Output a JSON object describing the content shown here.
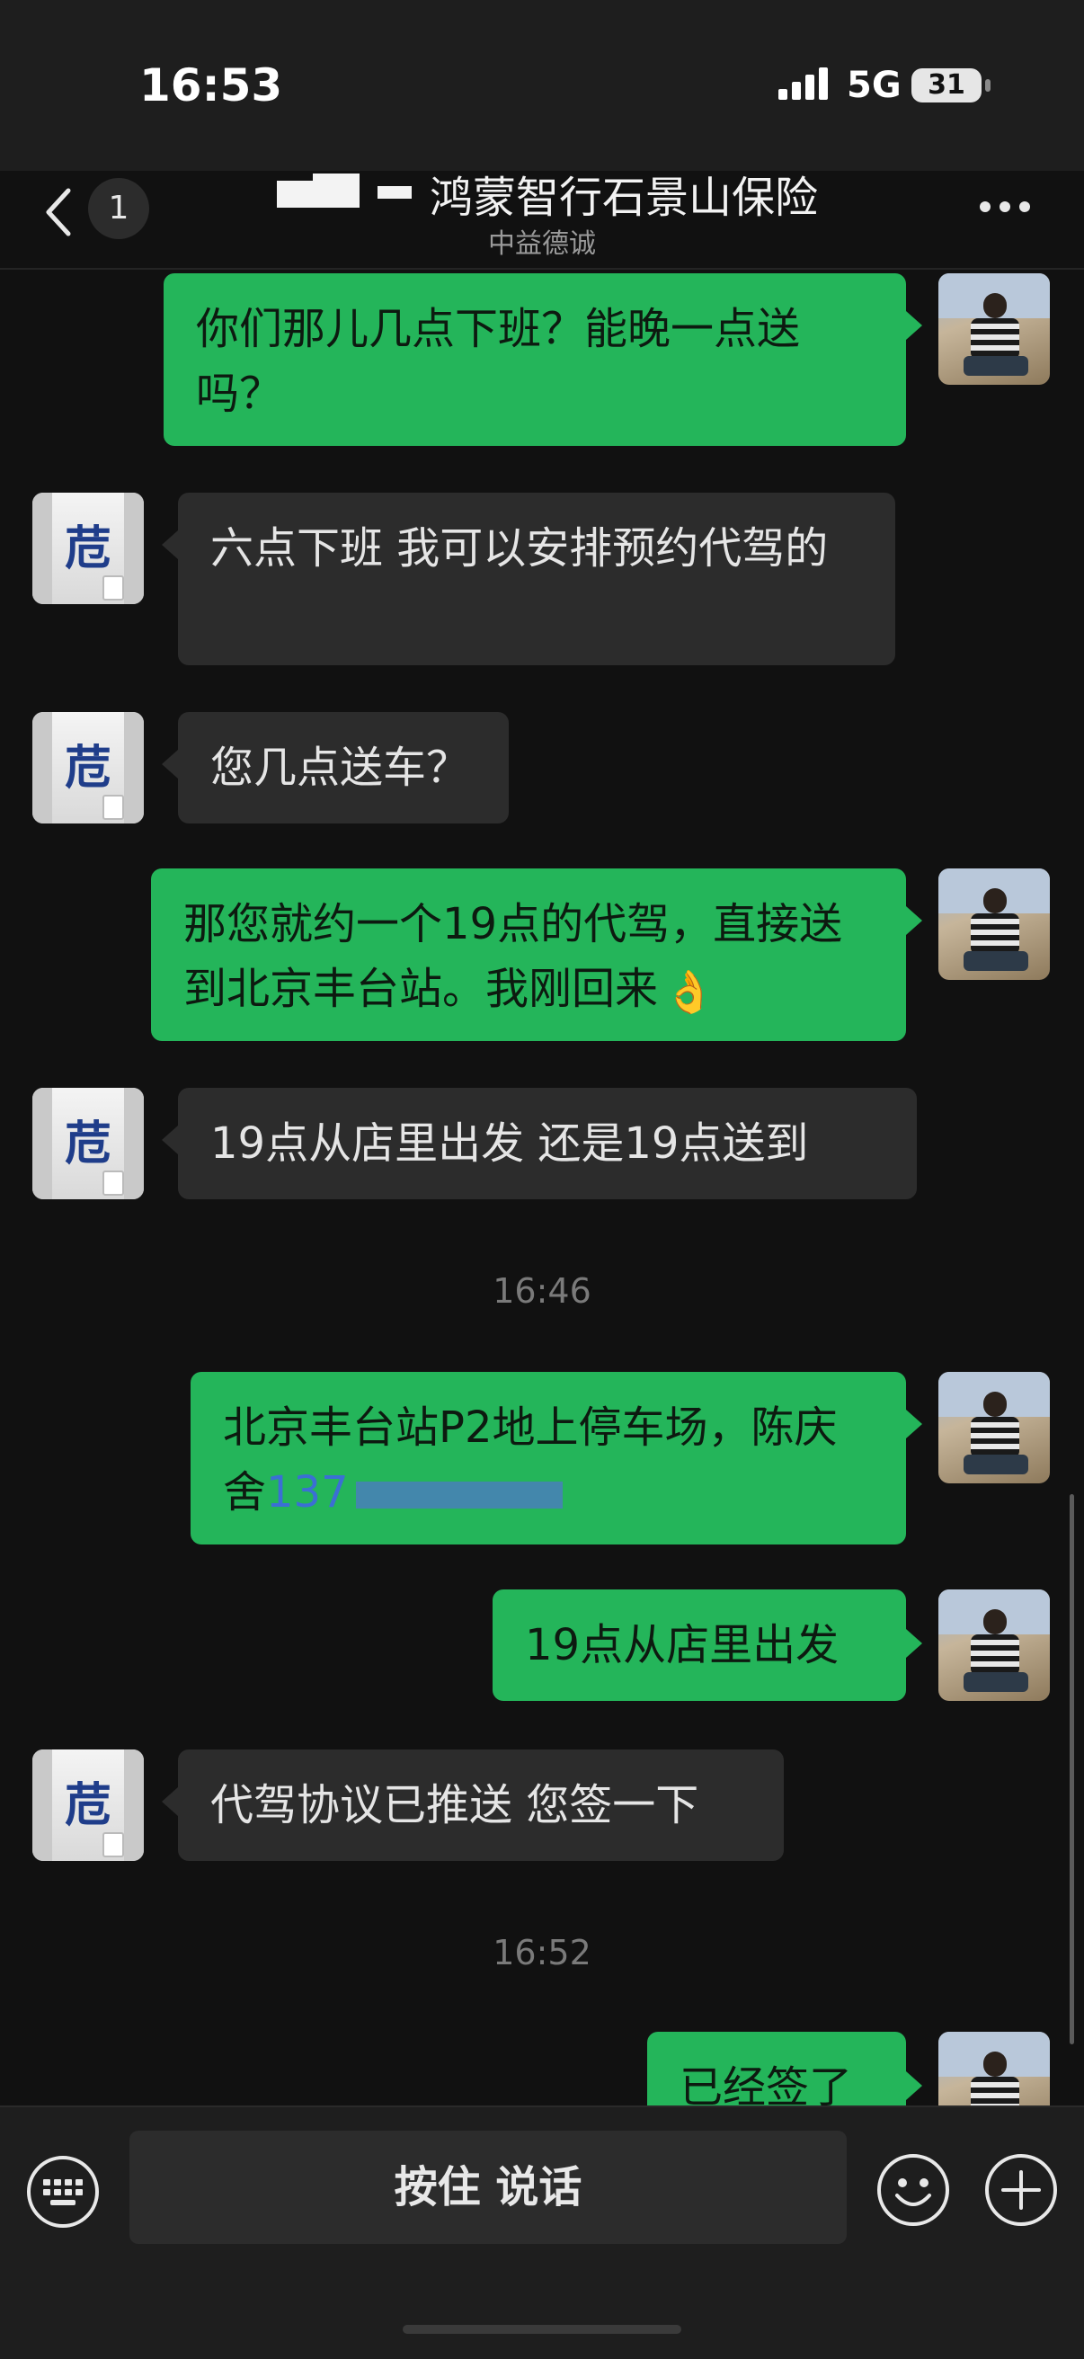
{
  "status": {
    "time": "16:53",
    "network": "5G",
    "battery": "31"
  },
  "header": {
    "unread_count": "1",
    "title": "鸿蒙智行石景山保险",
    "subtitle": "中益德诚"
  },
  "messages": [
    {
      "from": "me",
      "text": "你们那儿几点下班？能晚一点送吗？"
    },
    {
      "from": "them",
      "text": "六点下班 我可以安排预约代驾的"
    },
    {
      "from": "them",
      "text": "您几点送车？"
    },
    {
      "from": "me",
      "text": "那您就约一个19点的代驾，直接送到北京丰台站。我刚回来",
      "emoji": "👌"
    },
    {
      "from": "them",
      "text": "19点从店里出发 还是19点送到"
    },
    {
      "timestamp": "16:46"
    },
    {
      "from": "me",
      "text": "北京丰台站P2地上停车场，陈庆舍",
      "phone_visible": "137"
    },
    {
      "from": "me",
      "text": "19点从店里出发"
    },
    {
      "from": "them",
      "text": "代驾协议已推送 您签一下"
    },
    {
      "timestamp": "16:52"
    },
    {
      "from": "me",
      "text": "已经签了"
    }
  ],
  "input": {
    "voice_label": "按住 说话"
  },
  "icons": {
    "back": "chevron-left-icon",
    "more": "more-dots-icon",
    "keyboard": "keyboard-icon",
    "emoji": "smiley-icon",
    "plus": "plus-icon",
    "signal": "cellular-signal-icon"
  },
  "colors": {
    "outgoing_bubble": "#24b55a",
    "incoming_bubble": "#2c2c2c",
    "background": "#111111"
  }
}
